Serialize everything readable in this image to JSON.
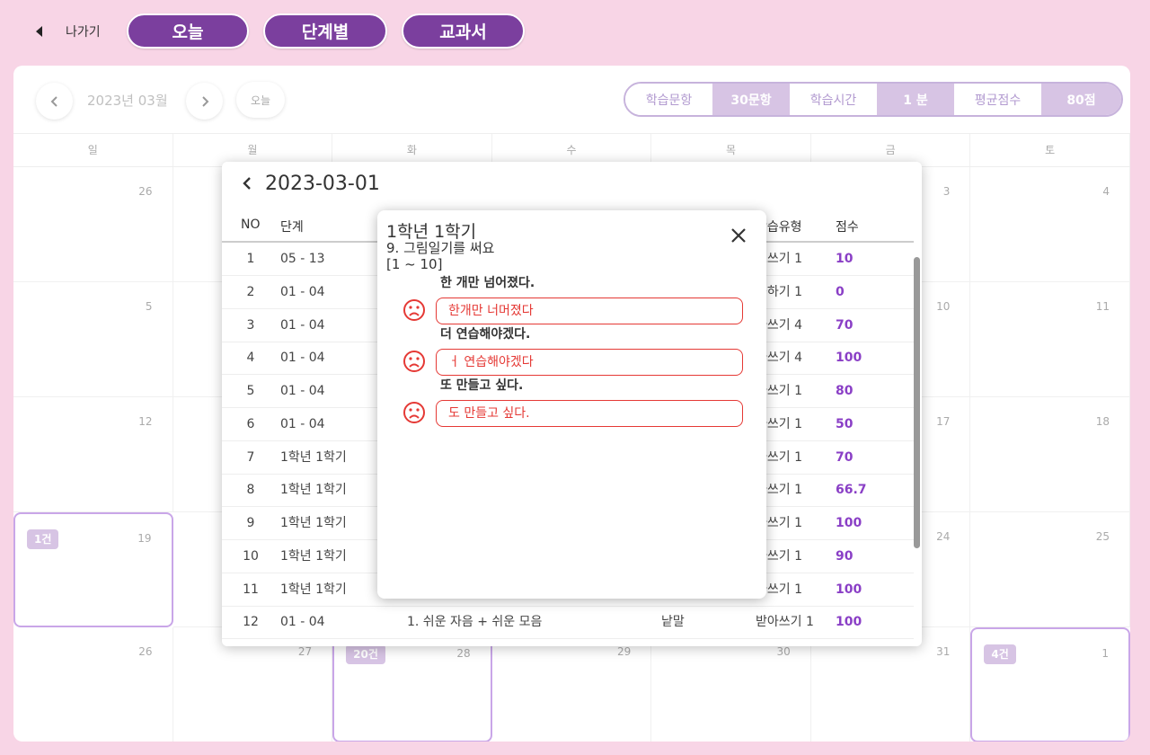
{
  "topbar": {
    "back_label": "나가기",
    "pills": [
      {
        "label": "오늘"
      },
      {
        "label": "단계별"
      },
      {
        "label": "교과서"
      }
    ]
  },
  "calendar": {
    "month_label": "2023년 03월",
    "today_label": "오늘",
    "stats": [
      {
        "label": "학습문항",
        "value": "30문항"
      },
      {
        "label": "학습시간",
        "value": "1 분"
      },
      {
        "label": "평균점수",
        "value": "80점"
      }
    ],
    "day_names": [
      "일",
      "월",
      "화",
      "수",
      "목",
      "금",
      "토"
    ],
    "weeks": [
      [
        {
          "day": "26"
        },
        {
          "day": ""
        },
        {
          "day": ""
        },
        {
          "day": ""
        },
        {
          "day": ""
        },
        {
          "day": "3"
        },
        {
          "day": "4"
        }
      ],
      [
        {
          "day": "5"
        },
        {
          "day": ""
        },
        {
          "day": ""
        },
        {
          "day": ""
        },
        {
          "day": ""
        },
        {
          "day": "10"
        },
        {
          "day": "11"
        }
      ],
      [
        {
          "day": "12"
        },
        {
          "day": ""
        },
        {
          "day": ""
        },
        {
          "day": ""
        },
        {
          "day": ""
        },
        {
          "day": "17"
        },
        {
          "day": "18"
        }
      ],
      [
        {
          "day": "19",
          "badge": "1건",
          "selected": true
        },
        {
          "day": ""
        },
        {
          "day": ""
        },
        {
          "day": ""
        },
        {
          "day": ""
        },
        {
          "day": "24"
        },
        {
          "day": "25"
        }
      ],
      [
        {
          "day": "26"
        },
        {
          "day": "27"
        },
        {
          "day": "28",
          "badge": "20건",
          "selected": true
        },
        {
          "day": "29"
        },
        {
          "day": "30"
        },
        {
          "day": "31"
        },
        {
          "day": "1",
          "badge": "4건",
          "selected": true
        }
      ]
    ]
  },
  "popup": {
    "date": "2023-03-01",
    "headers": {
      "no": "NO",
      "stage": "단계",
      "type": "학습유형",
      "score": "점수"
    },
    "rows": [
      {
        "no": "1",
        "stage": "05 - 13",
        "content": "",
        "category": "",
        "type": "고쓰기 1",
        "score": "10"
      },
      {
        "no": "2",
        "stage": "01 - 04",
        "content": "",
        "category": "",
        "type": "습하기 1",
        "score": "0"
      },
      {
        "no": "3",
        "stage": "01 - 04",
        "content": "",
        "category": "",
        "type": "아쓰기 4",
        "score": "70"
      },
      {
        "no": "4",
        "stage": "01 - 04",
        "content": "",
        "category": "",
        "type": "아쓰기 4",
        "score": "100"
      },
      {
        "no": "5",
        "stage": "01 - 04",
        "content": "",
        "category": "",
        "type": "아쓰기 1",
        "score": "80"
      },
      {
        "no": "6",
        "stage": "01 - 04",
        "content": "",
        "category": "",
        "type": "아쓰기 1",
        "score": "50"
      },
      {
        "no": "7",
        "stage": "1학년 1학기",
        "content": "",
        "category": "",
        "type": "아쓰기 1",
        "score": "70"
      },
      {
        "no": "8",
        "stage": "1학년 1학기",
        "content": "",
        "category": "",
        "type": "아쓰기 1",
        "score": "66.7"
      },
      {
        "no": "9",
        "stage": "1학년 1학기",
        "content": "",
        "category": "",
        "type": "아쓰기 1",
        "score": "100"
      },
      {
        "no": "10",
        "stage": "1학년 1학기",
        "content": "",
        "category": "",
        "type": "아쓰기 1",
        "score": "90"
      },
      {
        "no": "11",
        "stage": "1학년 1학기",
        "content": "",
        "category": "",
        "type": "아쓰기 1",
        "score": "100"
      },
      {
        "no": "12",
        "stage": "01 - 04",
        "content": "1. 쉬운 자음 + 쉬운 모음",
        "category": "낱말",
        "type": "받아쓰기 1",
        "score": "100"
      }
    ]
  },
  "modal": {
    "title": "1학년 1학기",
    "subtitle": "9. 그림일기를 써요",
    "range": "[1 ~ 10]",
    "items": [
      {
        "prompt": "한 개만 넘어졌다.",
        "answer": "한개만 너머졌다",
        "result_icon": "sad-face-icon"
      },
      {
        "prompt": "더 연습해야겠다.",
        "answer": "ㅓ 연습해야겠다",
        "result_icon": "sad-face-icon"
      },
      {
        "prompt": "또 만들고 싶다.",
        "answer": "도 만들고 싶다.",
        "result_icon": "sad-face-icon"
      }
    ]
  },
  "colors": {
    "background": "#f8d5e6",
    "accent": "#7b3f9e",
    "score": "#8a3fc6",
    "wrong": "#e53935",
    "badge": "#d7c4e4"
  }
}
